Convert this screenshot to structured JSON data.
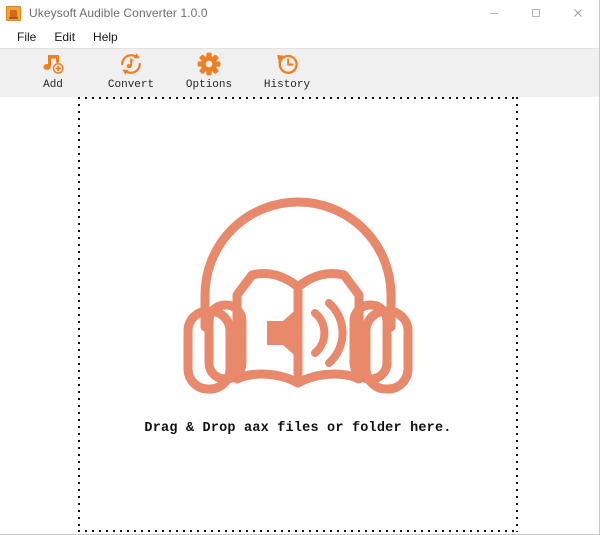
{
  "window": {
    "title": "Ukeysoft Audible Converter 1.0.0",
    "app_icon": "app-logo-icon",
    "controls": {
      "minimize": "minimize-icon",
      "maximize": "maximize-icon",
      "close": "close-icon"
    }
  },
  "menubar": {
    "items": [
      {
        "label": "File"
      },
      {
        "label": "Edit"
      },
      {
        "label": "Help"
      }
    ]
  },
  "toolbar": {
    "background": "#f0f0f0",
    "accent": "#ef7f22",
    "buttons": [
      {
        "label": "Add",
        "icon": "music-note-plus-icon"
      },
      {
        "label": "Convert",
        "icon": "refresh-music-note-icon"
      },
      {
        "label": "Options",
        "icon": "gear-icon"
      },
      {
        "label": "History",
        "icon": "clock-history-icon"
      }
    ]
  },
  "dropzone": {
    "icon": "audiobook-headphones-book-icon",
    "icon_color": "#e8896b",
    "message": "Drag & Drop aax files or folder here.",
    "border_style": "dotted"
  }
}
